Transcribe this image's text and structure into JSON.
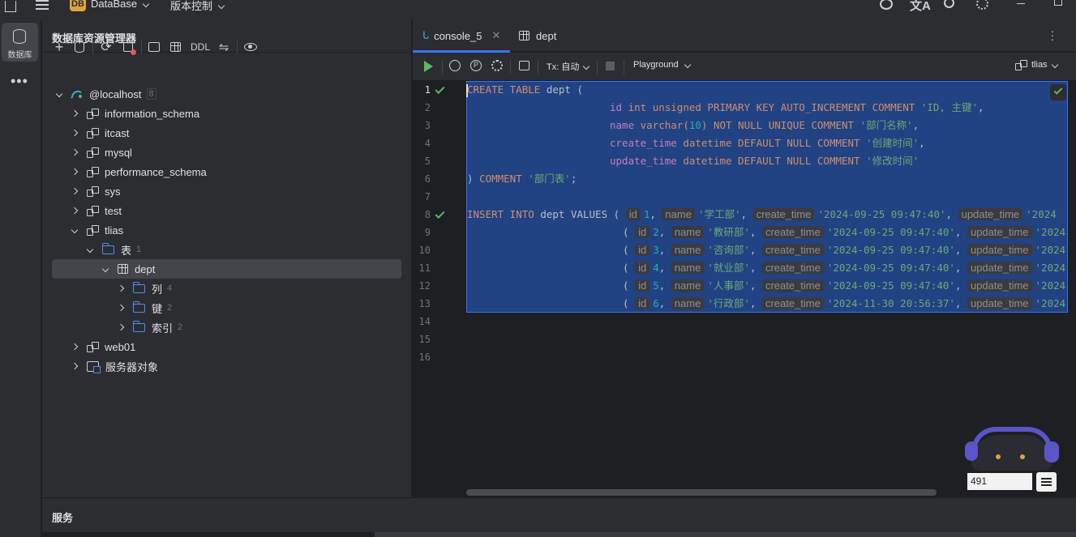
{
  "titlebar": {
    "project_badge": "DB",
    "project_name": "DataBase",
    "vcs": "版本控制"
  },
  "toolstrip": {
    "db_label": "数据库"
  },
  "explorer": {
    "title": "数据库资源管理器",
    "toolbar": {
      "ddl": "DDL"
    },
    "tree": [
      {
        "label": "@localhost",
        "count": "8",
        "type": "host",
        "expanded": true
      },
      {
        "label": "information_schema",
        "type": "schema"
      },
      {
        "label": "itcast",
        "type": "schema"
      },
      {
        "label": "mysql",
        "type": "schema"
      },
      {
        "label": "performance_schema",
        "type": "schema"
      },
      {
        "label": "sys",
        "type": "schema"
      },
      {
        "label": "test",
        "type": "schema"
      },
      {
        "label": "tlias",
        "type": "schema",
        "expanded": true
      },
      {
        "label": "表",
        "count": "1",
        "type": "folder",
        "expanded": true
      },
      {
        "label": "dept",
        "type": "table",
        "expanded": true,
        "selected": true
      },
      {
        "label": "列",
        "count": "4",
        "type": "folder"
      },
      {
        "label": "键",
        "count": "2",
        "type": "folder"
      },
      {
        "label": "索引",
        "count": "2",
        "type": "folder"
      },
      {
        "label": "web01",
        "type": "schema"
      },
      {
        "label": "服务器对象",
        "type": "server"
      }
    ]
  },
  "tabs": [
    {
      "label": "console_5",
      "active": true
    },
    {
      "label": "dept",
      "active": false
    }
  ],
  "editor_toolbar": {
    "tx": "Tx: 自动",
    "playground": "Playground",
    "datasource": "tlias"
  },
  "line_numbers": [
    "1",
    "2",
    "3",
    "4",
    "5",
    "6",
    "7",
    "8",
    "9",
    "10",
    "11",
    "12",
    "13",
    "14",
    "15",
    "16"
  ],
  "code": {
    "l1": [
      "CREATE TABLE",
      " dept ("
    ],
    "l2": [
      "id",
      " int unsigned PRIMARY KEY AUTO_INCREMENT COMMENT ",
      "'ID, 主键'",
      ","
    ],
    "l3": [
      "name",
      " varchar(",
      "10",
      ") NOT NULL UNIQUE COMMENT ",
      "'部门名称'",
      ","
    ],
    "l4": [
      "create_time",
      " datetime DEFAULT NULL COMMENT ",
      "'创建时间'",
      ","
    ],
    "l5": [
      "update_time",
      " datetime DEFAULT NULL COMMENT ",
      "'修改时间'"
    ],
    "l6": [
      ") COMMENT ",
      "'部门表'",
      ";"
    ],
    "insert_kw": "INSERT INTO",
    "insert_rest": " dept VALUES (",
    "rows": [
      {
        "id": "1",
        "name": "'学工部'",
        "ct": "'2024-09-25 09:47:40'",
        "ut": "'2024"
      },
      {
        "id": "2",
        "name": "'教研部'",
        "ct": "'2024-09-25 09:47:40'",
        "ut": "'2024"
      },
      {
        "id": "3",
        "name": "'咨询部'",
        "ct": "'2024-09-25 09:47:40'",
        "ut": "'2024"
      },
      {
        "id": "4",
        "name": "'就业部'",
        "ct": "'2024-09-25 09:47:40'",
        "ut": "'2024"
      },
      {
        "id": "5",
        "name": "'人事部'",
        "ct": "'2024-09-25 09:47:40'",
        "ut": "'2024"
      },
      {
        "id": "6",
        "name": "'行政部'",
        "ct": "'2024-11-30 20:56:37'",
        "ut": "'2024"
      }
    ],
    "hints": {
      "id": "id",
      "name": "name",
      "ct": "create_time",
      "ut": "update_time"
    }
  },
  "services": {
    "title": "服务"
  },
  "widget": {
    "counter": "491"
  }
}
